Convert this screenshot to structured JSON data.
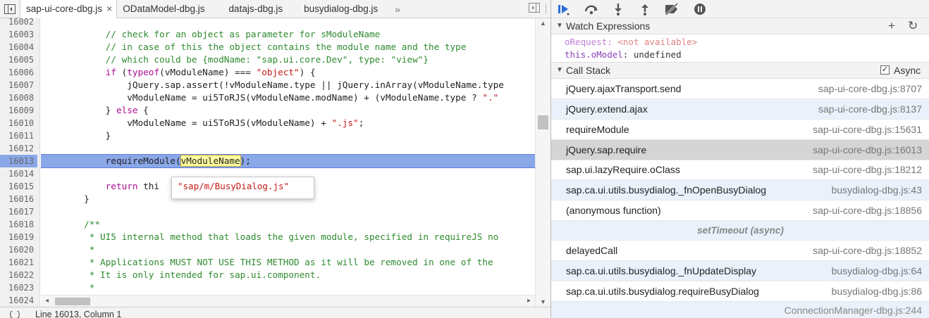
{
  "tabs": [
    {
      "label": "sap-ui-core-dbg.js",
      "active": true,
      "close": "×"
    },
    {
      "label": "ODataModel-dbg.js",
      "active": false
    },
    {
      "label": "datajs-dbg.js",
      "active": false
    },
    {
      "label": "busydialog-dbg.js",
      "active": false
    }
  ],
  "tabs_overflow": "»",
  "editor": {
    "line_numbers": [
      "16002",
      "16003",
      "16004",
      "16005",
      "16006",
      "16007",
      "16008",
      "16009",
      "16010",
      "16011",
      "16012",
      "16013",
      "16014",
      "16015",
      "16016",
      "16017",
      "16018",
      "16019",
      "16020",
      "16021",
      "16022",
      "16023",
      "16024"
    ],
    "highlighted_line": "16013",
    "tooltip": "\"sap/m/BusyDialog.js\""
  },
  "status": {
    "text": "Line 16013, Column 1"
  },
  "sidebar": {
    "watch": {
      "title": "Watch Expressions",
      "add": "+",
      "refresh": "↻",
      "items": [
        {
          "name": "oRequest",
          "sep": ": ",
          "value": "<not available>"
        },
        {
          "name": "this.oModel",
          "sep": ": ",
          "value": "undefined"
        }
      ]
    },
    "callstack": {
      "title": "Call Stack",
      "async_label": "Async",
      "async_checked": "✓",
      "frames": [
        {
          "fn": "jQuery.ajaxTransport.send",
          "loc": "sap-ui-core-dbg.js:8707"
        },
        {
          "fn": "jQuery.extend.ajax",
          "loc": "sap-ui-core-dbg.js:8137"
        },
        {
          "fn": "requireModule",
          "loc": "sap-ui-core-dbg.js:15631"
        },
        {
          "fn": "jQuery.sap.require",
          "loc": "sap-ui-core-dbg.js:16013"
        },
        {
          "fn": "sap.ui.lazyRequire.oClass",
          "loc": "sap-ui-core-dbg.js:18212"
        },
        {
          "fn": "sap.ca.ui.utils.busydialog._fnOpenBusyDialog",
          "loc": "busydialog-dbg.js:43"
        },
        {
          "fn": "(anonymous function)",
          "loc": "sap-ui-core-dbg.js:18856"
        }
      ],
      "async_separator": "setTimeout (async)",
      "frames2": [
        {
          "fn": "delayedCall",
          "loc": "sap-ui-core-dbg.js:18852"
        },
        {
          "fn": "sap.ca.ui.utils.busydialog._fnUpdateDisplay",
          "loc": "busydialog-dbg.js:64"
        },
        {
          "fn": "sap.ca.ui.utils.busydialog.requireBusyDialog",
          "loc": "busydialog-dbg.js:86"
        },
        {
          "fn": "",
          "loc": "ConnectionManager-dbg.js:244"
        }
      ]
    }
  },
  "colors": {
    "highlight": "#8aa7e8",
    "comment": "#2f8a2f",
    "keyword": "#aa0d91",
    "string": "#c41a16",
    "selected_frame": "#d5d5d5"
  }
}
